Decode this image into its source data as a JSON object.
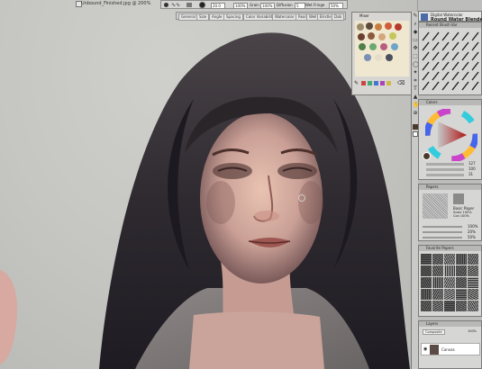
{
  "document": {
    "title": "Unbound_Finished.jpg @ 200%"
  },
  "property_bar": {
    "size_value": "20.0",
    "opacity_label": "Opacity",
    "opacity_value": "100%",
    "grain_label": "Grain",
    "grain_value": "100%",
    "diffusion_label": "Diffusion",
    "diffusion_value": "5",
    "wet_fringe_label": "Wet Fringe",
    "wet_fringe_value": "50%"
  },
  "brush_selector_bar": {
    "tabs": [
      "General",
      "Size",
      "Angle",
      "Spacing",
      "Color Variability",
      "Watercolor",
      "Real",
      "Well",
      "Bristle",
      "Dab"
    ]
  },
  "mixer": {
    "title": "Mixer"
  },
  "brush_header": {
    "category": "Digital Watercolor",
    "variant": "Round Water Blender"
  },
  "recent_panel": {
    "title": "Recent Brush Var"
  },
  "colors_panel": {
    "title": "Colors",
    "values": [
      "127",
      "100",
      "31"
    ]
  },
  "papers_panel": {
    "title": "Papers",
    "paper_name": "Basic Paper",
    "lines": [
      "Scale 100%",
      "Con 100%",
      "Bri 50%"
    ],
    "values": [
      "100%",
      "20%",
      "50%"
    ]
  },
  "paper_library": {
    "title": "Favorite Papers"
  },
  "layers_panel": {
    "title": "Layers",
    "tabs": [
      "Composite",
      "Default"
    ],
    "opacity": "100%",
    "layer_name": "Canvas"
  },
  "colors": {
    "accent_selection": "#4a3a2c",
    "mixer_pad": "#efe7cf"
  }
}
